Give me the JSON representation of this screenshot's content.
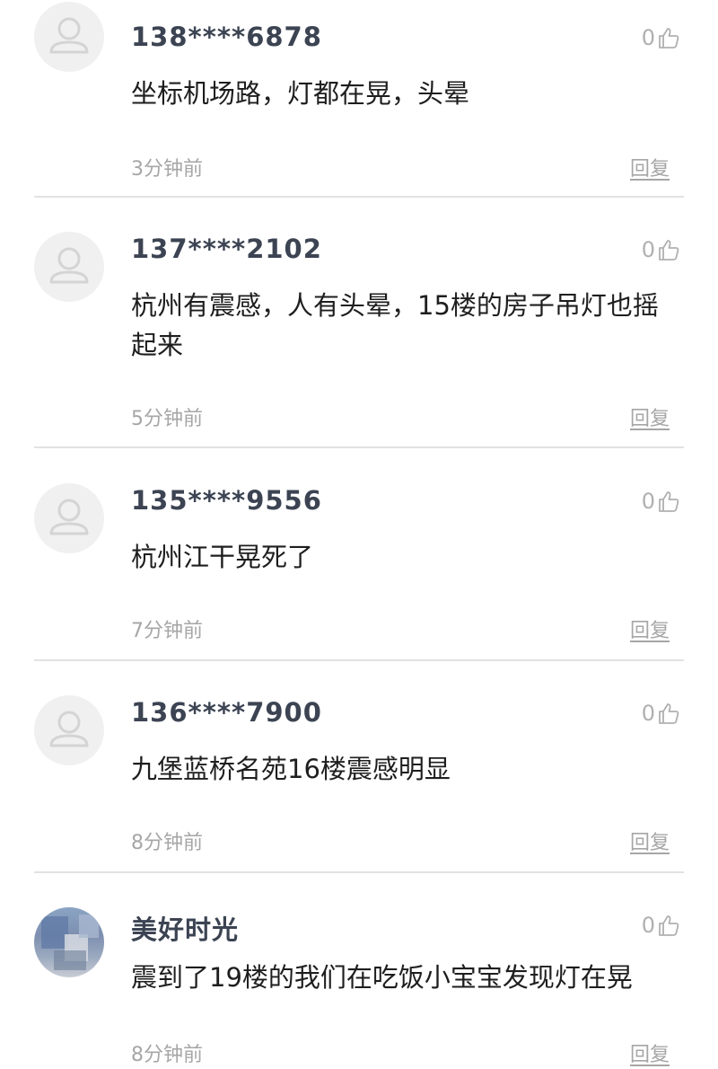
{
  "comments": [
    {
      "username": "138****6878",
      "likes": "0",
      "text": "坐标机场路，灯都在晃，头晕",
      "time": "3分钟前",
      "reply_label": "回复",
      "avatar": "default-avatar"
    },
    {
      "username": "137****2102",
      "likes": "0",
      "text": "杭州有震感，人有头晕，15楼的房子吊灯也摇起来",
      "time": "5分钟前",
      "reply_label": "回复",
      "avatar": "default-avatar"
    },
    {
      "username": "135****9556",
      "likes": "0",
      "text": "杭州江干晃死了",
      "time": "7分钟前",
      "reply_label": "回复",
      "avatar": "default-avatar"
    },
    {
      "username": "136****7900",
      "likes": "0",
      "text": "九堡蓝桥名苑16楼震感明显",
      "time": "8分钟前",
      "reply_label": "回复",
      "avatar": "default-avatar"
    },
    {
      "username": "美好时光",
      "likes": "0",
      "text": "震到了19楼的我们在吃饭小宝宝发现灯在晃",
      "time": "8分钟前",
      "reply_label": "回复",
      "avatar": "photo-avatar-blurred"
    }
  ],
  "colors": {
    "username": "#3c4453",
    "text": "#1e1e1e",
    "meta": "#a6a6a6",
    "divider": "#e2e2e2"
  }
}
